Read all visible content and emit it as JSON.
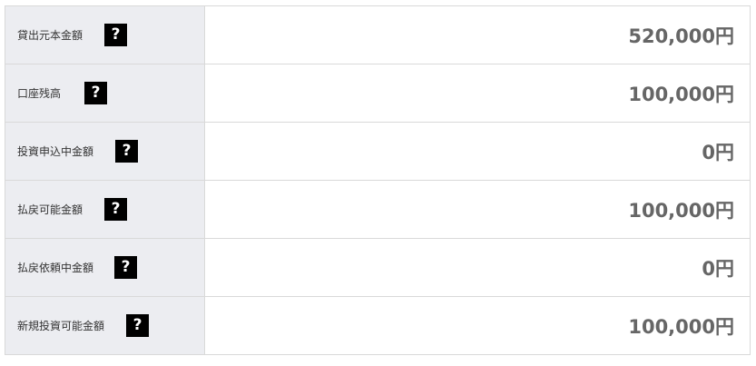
{
  "rows": [
    {
      "label": "貸出元本金額",
      "help_glyph": "?",
      "value": "520,000円"
    },
    {
      "label": "口座残高",
      "help_glyph": "?",
      "value": "100,000円"
    },
    {
      "label": "投資申込中金額",
      "help_glyph": "?",
      "value": "0円"
    },
    {
      "label": "払戻可能金額",
      "help_glyph": "?",
      "value": "100,000円"
    },
    {
      "label": "払戻依頼中金額",
      "help_glyph": "?",
      "value": "0円"
    },
    {
      "label": "新規投資可能金額",
      "help_glyph": "?",
      "value": "100,000円"
    }
  ],
  "icons": {
    "help": "question-mark-icon"
  },
  "colors": {
    "label_background": "#ecedf1",
    "border": "#d9d9d9",
    "value_text": "#666666",
    "help_icon_background": "#000000"
  }
}
